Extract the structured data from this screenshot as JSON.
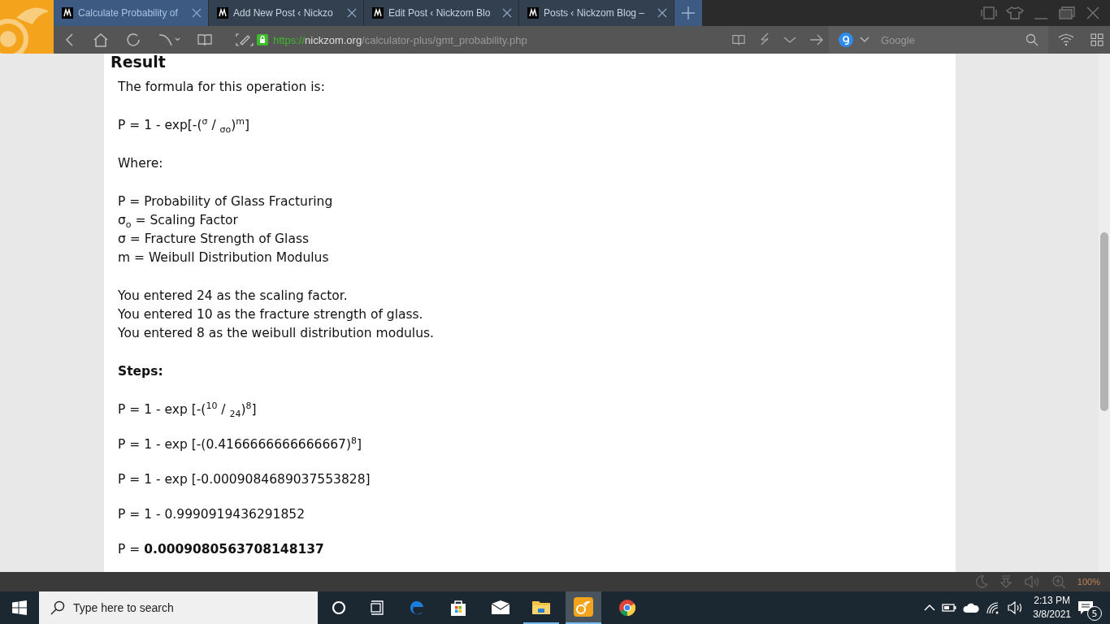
{
  "browser": {
    "tabs": [
      {
        "label": "Calculate Probability of",
        "selected": true
      },
      {
        "label": "Add New Post ‹ Nickzo",
        "selected": false
      },
      {
        "label": "Edit Post ‹ Nickzom Blo",
        "selected": false
      },
      {
        "label": "Posts ‹ Nickzom Blog –",
        "selected": false
      }
    ],
    "url": {
      "scheme": "https://",
      "domain": "nickzom.org",
      "path": "/calculator-plus/gmt_probability.php"
    },
    "search_placeholder": "Google",
    "zoom": "100%"
  },
  "content": {
    "heading": "Result",
    "sections": [
      {
        "kind": "text",
        "lines": [
          "The formula for this operation is:"
        ]
      },
      {
        "kind": "text",
        "lines": [
          "P = 1 - exp[-($^{σ}$ / $_{σo}$)$^{m}$]"
        ]
      },
      {
        "kind": "text",
        "lines": [
          "Where:"
        ]
      },
      {
        "kind": "text",
        "lines": [
          "P = Probability of Glass Fracturing",
          "σ$_{o}$ = Scaling Factor",
          "σ = Fracture Strength of Glass",
          "m = Weibull Distribution Modulus"
        ]
      },
      {
        "kind": "text",
        "lines": [
          "You entered 24 as the scaling factor.",
          "You entered 10 as the fracture strength of glass.",
          "You entered 8 as the weibull distribution modulus."
        ]
      },
      {
        "kind": "title",
        "lines": [
          "Steps:"
        ]
      },
      {
        "kind": "step",
        "lines": [
          "P = 1 - exp [-($^{10}$ / $_{24}$)$^{8}$]"
        ]
      },
      {
        "kind": "step",
        "lines": [
          "P = 1 - exp [-(0.4166666666666667)$^{8}$]"
        ]
      },
      {
        "kind": "step",
        "lines": [
          "P = 1 - exp [-0.0009084689037553828]"
        ]
      },
      {
        "kind": "step",
        "lines": [
          "P = 1 - 0.9990919436291852"
        ]
      },
      {
        "kind": "step",
        "lines": [
          "P = **0.0009080563708148137**"
        ]
      }
    ]
  },
  "taskbar": {
    "search_placeholder": "Type here to search",
    "time": "2:13 PM",
    "date": "3/8/2021",
    "notifications": "5"
  }
}
